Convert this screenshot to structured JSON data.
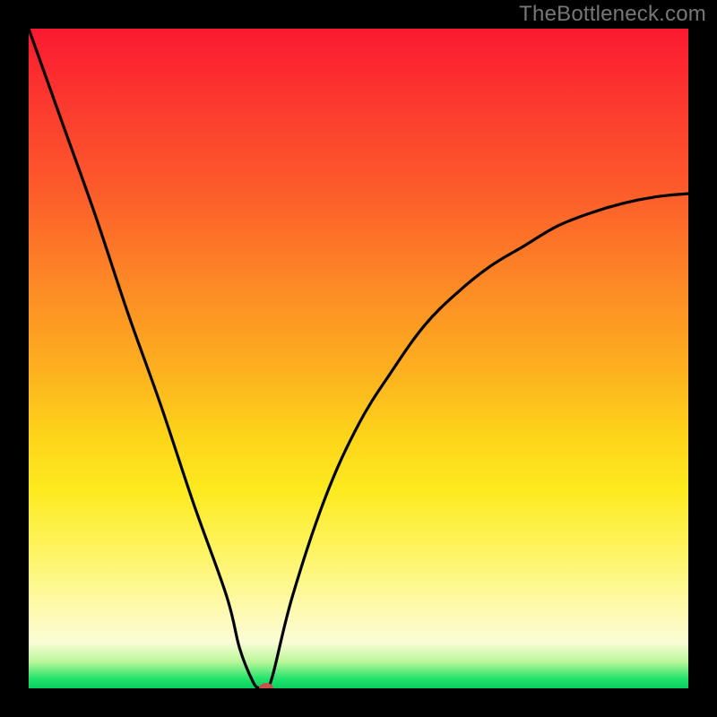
{
  "watermark": "TheBottleneck.com",
  "colors": {
    "curve": "#000000",
    "dot": "#c9524b",
    "frame": "#000000"
  },
  "chart_data": {
    "type": "line",
    "title": "",
    "xlabel": "",
    "ylabel": "",
    "xlim": [
      0,
      100
    ],
    "ylim": [
      0,
      100
    ],
    "grid": false,
    "legend": false,
    "series": [
      {
        "name": "bottleneck-curve",
        "x": [
          0,
          5,
          10,
          15,
          20,
          25,
          30,
          32,
          34,
          35,
          36,
          37,
          40,
          45,
          50,
          55,
          60,
          65,
          70,
          75,
          80,
          85,
          90,
          95,
          100
        ],
        "values": [
          100,
          86,
          72,
          57,
          43,
          28,
          14,
          6,
          1,
          0,
          0,
          2,
          14,
          29,
          40,
          48,
          55,
          60,
          64,
          67,
          70,
          72,
          73.5,
          74.5,
          75
        ]
      }
    ],
    "marker": {
      "x": 36,
      "y": 0,
      "label": "optimal-point"
    },
    "background_gradient": {
      "direction": "vertical",
      "stops": [
        {
          "pos": 0.0,
          "color": "#fb1931"
        },
        {
          "pos": 0.24,
          "color": "#fd5a2b"
        },
        {
          "pos": 0.52,
          "color": "#fdb11f"
        },
        {
          "pos": 0.7,
          "color": "#fdea1f"
        },
        {
          "pos": 0.88,
          "color": "#fefab0"
        },
        {
          "pos": 0.96,
          "color": "#b9f79a"
        },
        {
          "pos": 1.0,
          "color": "#07d061"
        }
      ]
    }
  }
}
